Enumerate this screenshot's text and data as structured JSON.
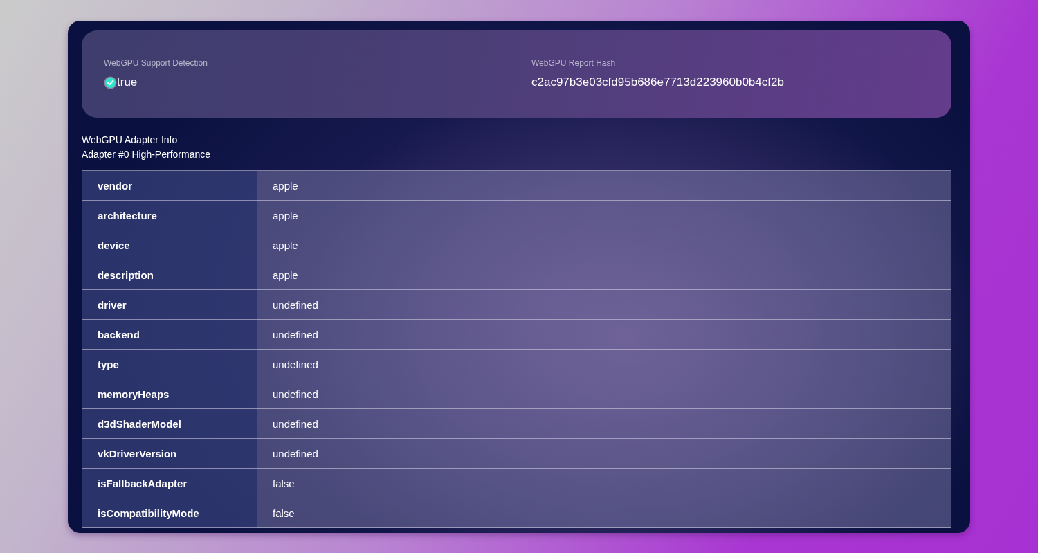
{
  "support": {
    "label": "WebGPU Support Detection",
    "value": "true",
    "supported": true
  },
  "hash": {
    "label": "WebGPU Report Hash",
    "value": "c2ac97b3e03cfd95b686e7713d223960b0b4cf2b"
  },
  "adapter_info": {
    "title": "WebGPU Adapter Info",
    "subtitle": "Adapter #0 High-Performance"
  },
  "table": {
    "rows": [
      {
        "key": "vendor",
        "value": "apple"
      },
      {
        "key": "architecture",
        "value": "apple"
      },
      {
        "key": "device",
        "value": "apple"
      },
      {
        "key": "description",
        "value": "apple"
      },
      {
        "key": "driver",
        "value": "undefined"
      },
      {
        "key": "backend",
        "value": "undefined"
      },
      {
        "key": "type",
        "value": "undefined"
      },
      {
        "key": "memoryHeaps",
        "value": "undefined"
      },
      {
        "key": "d3dShaderModel",
        "value": "undefined"
      },
      {
        "key": "vkDriverVersion",
        "value": "undefined"
      },
      {
        "key": "isFallbackAdapter",
        "value": "false"
      },
      {
        "key": "isCompatibilityMode",
        "value": "false"
      }
    ]
  }
}
